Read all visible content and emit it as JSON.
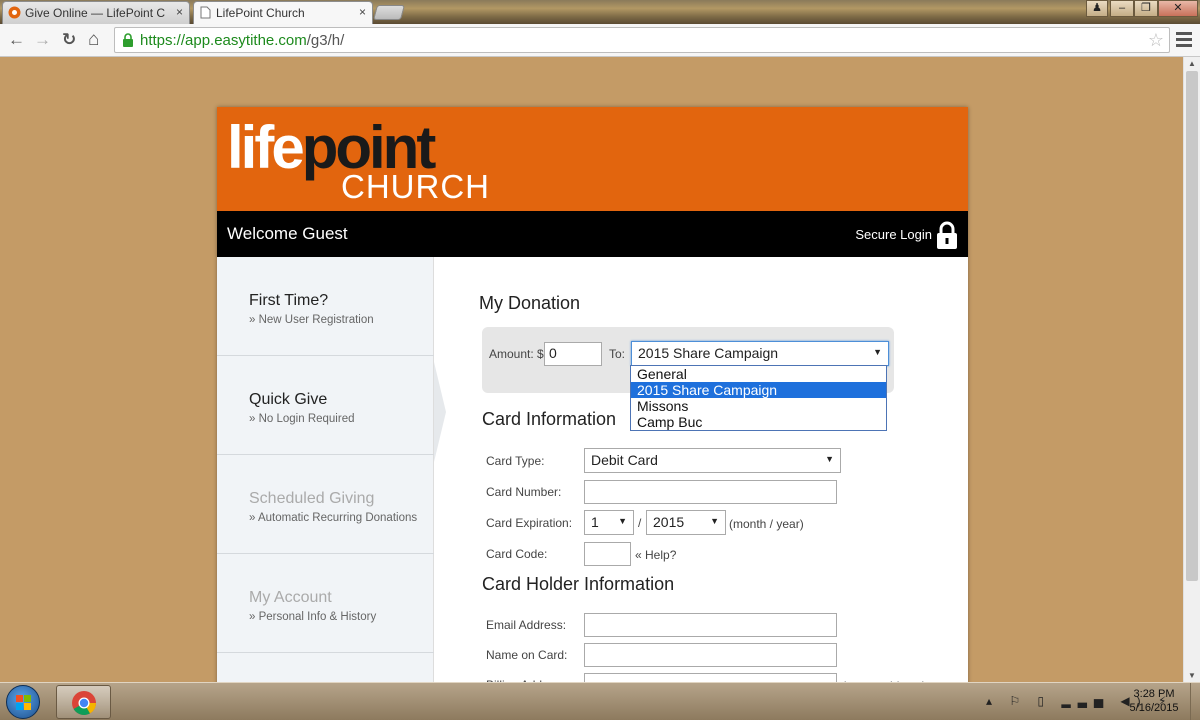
{
  "browser": {
    "tabs": [
      {
        "title": "Give Online — LifePoint C",
        "close": "×"
      },
      {
        "title": "LifePoint Church",
        "close": "×"
      }
    ],
    "url_scheme_host": "https://app.easytithe.com",
    "url_path": "/g3/h/",
    "star": "☆",
    "back": "←",
    "forward": "→",
    "reload": "↻",
    "home": "⌂"
  },
  "site": {
    "logo_life": "life",
    "logo_point": "point",
    "logo_church": "CHURCH",
    "welcome": "Welcome Guest",
    "secure_login": "Secure Login"
  },
  "sidebar": {
    "items": [
      {
        "title": "First Time?",
        "subtitle": "» New User Registration"
      },
      {
        "title": "Quick Give",
        "subtitle": "» No Login Required"
      },
      {
        "title": "Scheduled Giving",
        "subtitle": "» Automatic Recurring Donations"
      },
      {
        "title": "My Account",
        "subtitle": "» Personal Info & History"
      }
    ]
  },
  "donation": {
    "heading": "My Donation",
    "amount_label": "Amount: $",
    "amount_value": "0",
    "to_label": "To:",
    "fund_selected": "2015 Share Campaign",
    "fund_options": [
      "General",
      "2015 Share Campaign",
      "Missons",
      "Camp Buc"
    ],
    "highlighted_option": 1
  },
  "card": {
    "heading": "Card Information",
    "type_label": "Card Type:",
    "type_value": "Debit Card",
    "number_label": "Card Number:",
    "number_value": "",
    "expiration_label": "Card Expiration:",
    "exp_month": "1",
    "exp_sep": "/",
    "exp_year": "2015",
    "exp_hint": "(month / year)",
    "code_label": "Card Code:",
    "code_value": "",
    "help": "« Help?"
  },
  "holder": {
    "heading": "Card Holder Information",
    "email_label": "Email Address:",
    "name_label": "Name on Card:",
    "address_label": "Billing Address:",
    "address_hint": "(street address)"
  },
  "taskbar": {
    "time": "3:28 PM",
    "date": "5/16/2015",
    "tray": "▴ ⚐ ▯ ▂▃▅ ◀) ⚡"
  },
  "colors": {
    "banner": "#e2650e",
    "welcome_bar": "#000000",
    "page_bg": "#c49b66",
    "selection": "#1e70dc"
  }
}
